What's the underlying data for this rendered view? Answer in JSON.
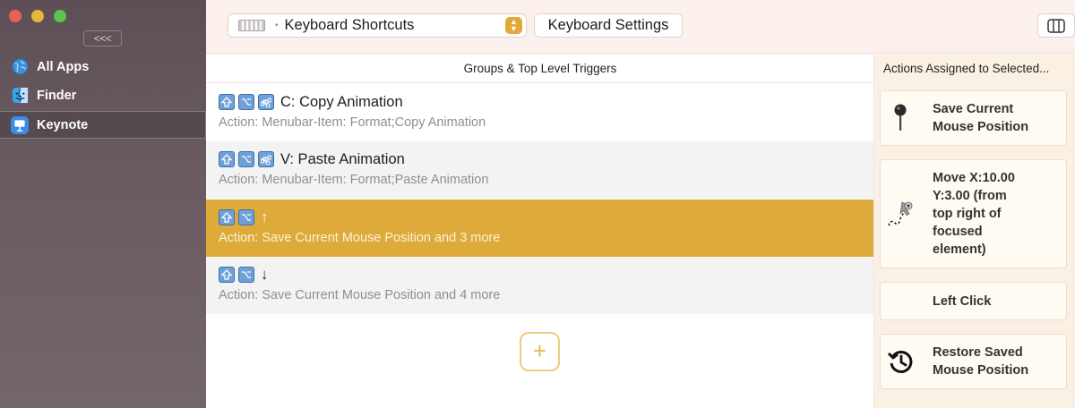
{
  "sidebar": {
    "collapse_label": "<<<",
    "items": [
      {
        "label": "All Apps",
        "icon": "globe-icon"
      },
      {
        "label": "Finder",
        "icon": "finder-icon"
      },
      {
        "label": "Keynote",
        "icon": "keynote-icon"
      }
    ],
    "selected": "Keynote"
  },
  "toolbar": {
    "trigger_type_label": "Keyboard Shortcuts",
    "settings_button_label": "Keyboard Settings"
  },
  "main": {
    "column_header": "Groups & Top Level Triggers",
    "rows": [
      {
        "modifiers": [
          "shift",
          "option",
          "command"
        ],
        "title": "C: Copy Animation",
        "subtitle": "Action: Menubar-Item: Format;Copy Animation",
        "selected": false
      },
      {
        "modifiers": [
          "shift",
          "option",
          "command"
        ],
        "title": "V: Paste Animation",
        "subtitle": "Action: Menubar-Item: Format;Paste Animation",
        "selected": false
      },
      {
        "modifiers": [
          "shift",
          "option"
        ],
        "title": "↑",
        "subtitle": "Action: Save Current Mouse Position and 3 more",
        "selected": true
      },
      {
        "modifiers": [
          "shift",
          "option"
        ],
        "title": "↓",
        "subtitle": "Action: Save Current Mouse Position and 4 more",
        "selected": false
      }
    ],
    "add_button_label": "+"
  },
  "actions": {
    "column_header": "Actions Assigned to Selected...",
    "items": [
      {
        "label_lines": [
          "Save Current",
          "Mouse Position"
        ],
        "icon": "pin-icon"
      },
      {
        "label_lines": [
          "Move X:10.00",
          "Y:3.00 (from",
          "top right of",
          "focused",
          "element)"
        ],
        "icon": "mouse-path-icon"
      },
      {
        "label_lines": [
          "Left Click"
        ],
        "icon": ""
      },
      {
        "label_lines": [
          "Restore Saved",
          "Mouse Position"
        ],
        "icon": "history-icon"
      }
    ]
  },
  "colors": {
    "accent": "#deab3a",
    "sidebar_bg": "#5d4f56",
    "keycap_blue": "#6ea0d9"
  }
}
